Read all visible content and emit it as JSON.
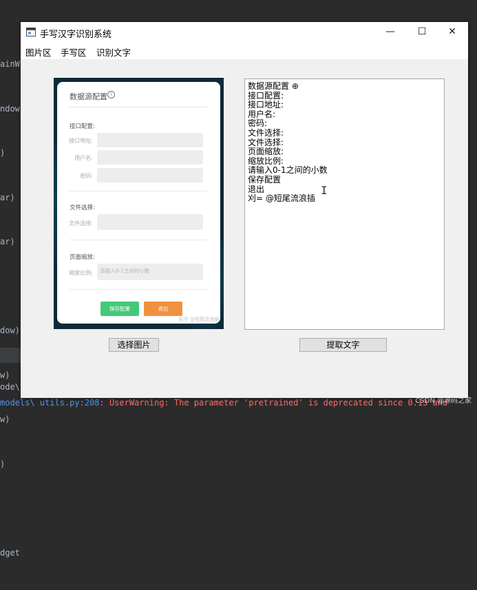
{
  "background_ide": {
    "code_fragments": [
      "ainW",
      "ndow",
      ")",
      "ar)",
      "ar)",
      "dow)",
      "w)",
      "w)",
      ")",
      "dget"
    ],
    "bottom_fragment": "ode\\",
    "console_link": "models\\ utils.py:208",
    "console_warning": ": UserWarning: The parameter 'pretrained' is deprecated since 0.13 and",
    "watermark": "CSDN @源码之家"
  },
  "window": {
    "title": "手写汉字识别系统",
    "controls": {
      "minimize": "—",
      "maximize": "☐",
      "close": "✕"
    }
  },
  "menu": {
    "items": [
      {
        "label": "图片区"
      },
      {
        "label": "手写区"
      },
      {
        "label": "识别文字"
      }
    ]
  },
  "image_panel": {
    "card_title": "数据源配置",
    "info_glyph": "i",
    "sections": {
      "interface": "接口配置:",
      "file": "文件选择:",
      "page_zoom": "页面缩放:"
    },
    "labels": {
      "interface_address": "接口地址:",
      "username": "用户名:",
      "password": "密码:",
      "file_select": "文件选择:",
      "zoom_ratio": "缩放比例:"
    },
    "zoom_placeholder": "请输入0-1之间的小数",
    "save_button": "保存配置",
    "exit_button": "退出",
    "watermark": "知乎 @短尾流浪猫"
  },
  "text_panel": {
    "lines": [
      "数据源配置 ⊕",
      "接口配置:",
      "接口地址:",
      "用户名:",
      "密码:",
      "文件选择:",
      "文件选择:",
      "页面缩放:",
      "缩放比例:",
      "请输入0-1之间的小数",
      "保存配置",
      "退出",
      "刈= @短尾流浪插"
    ],
    "cursor_glyph": "I"
  },
  "buttons": {
    "select_image": "选择图片",
    "extract_text": "提取文字"
  }
}
